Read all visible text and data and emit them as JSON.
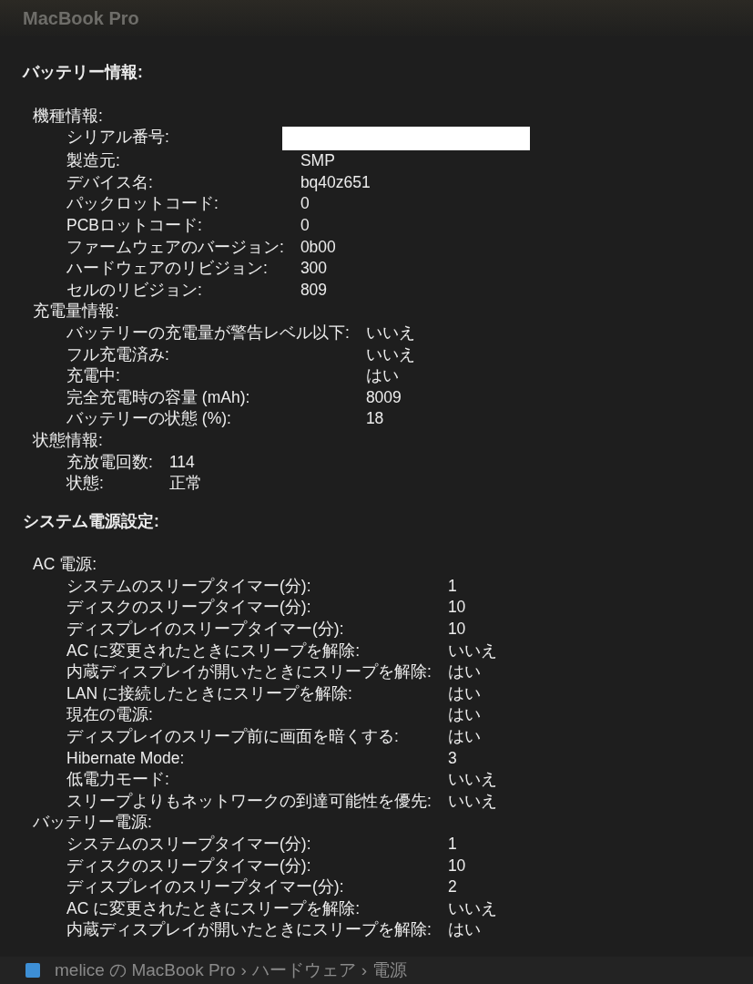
{
  "window": {
    "title": "MacBook Pro"
  },
  "sections": [
    {
      "heading": "バッテリー情報:",
      "groups": [
        {
          "label": "機種情報:",
          "rows": [
            {
              "label": "シリアル番号:",
              "redacted": true
            },
            {
              "label": "製造元:",
              "value": "SMP"
            },
            {
              "label": "デバイス名:",
              "value": "bq40z651"
            },
            {
              "label": "パックロットコード:",
              "value": "0"
            },
            {
              "label": "PCBロットコード:",
              "value": "0"
            },
            {
              "label": "ファームウェアのバージョン:",
              "value": "0b00"
            },
            {
              "label": "ハードウェアのリビジョン:",
              "value": "300"
            },
            {
              "label": "セルのリビジョン:",
              "value": "809"
            }
          ]
        },
        {
          "label": "充電量情報:",
          "rows": [
            {
              "label": "バッテリーの充電量が警告レベル以下:",
              "value": "いいえ"
            },
            {
              "label": "フル充電済み:",
              "value": "いいえ"
            },
            {
              "label": "充電中:",
              "value": "はい"
            },
            {
              "label": "完全充電時の容量 (mAh):",
              "value": "8009"
            },
            {
              "label": "バッテリーの状態 (%):",
              "value": "18"
            }
          ]
        },
        {
          "label": "状態情報:",
          "rows": [
            {
              "label": "充放電回数:",
              "value": "114"
            },
            {
              "label": "状態:",
              "value": "正常"
            }
          ]
        }
      ]
    },
    {
      "heading": "システム電源設定:",
      "groups": [
        {
          "label": "AC 電源:",
          "rows": [
            {
              "label": "システムのスリープタイマー(分):",
              "value": "1"
            },
            {
              "label": "ディスクのスリープタイマー(分):",
              "value": "10"
            },
            {
              "label": "ディスプレイのスリープタイマー(分):",
              "value": "10"
            },
            {
              "label": "AC に変更されたときにスリープを解除:",
              "value": "いいえ"
            },
            {
              "label": "内蔵ディスプレイが開いたときにスリープを解除:",
              "value": "はい"
            },
            {
              "label": "LAN に接続したときにスリープを解除:",
              "value": "はい"
            },
            {
              "label": "現在の電源:",
              "value": "はい"
            },
            {
              "label": "ディスプレイのスリープ前に画面を暗くする:",
              "value": "はい"
            },
            {
              "label": "Hibernate Mode:",
              "value": "3"
            },
            {
              "label": "低電力モード:",
              "value": "いいえ"
            },
            {
              "label": "スリープよりもネットワークの到達可能性を優先:",
              "value": "いいえ"
            }
          ]
        },
        {
          "label": "バッテリー電源:",
          "rows": [
            {
              "label": "システムのスリープタイマー(分):",
              "value": "1"
            },
            {
              "label": "ディスクのスリープタイマー(分):",
              "value": "10"
            },
            {
              "label": "ディスプレイのスリープタイマー(分):",
              "value": "2"
            },
            {
              "label": "AC に変更されたときにスリープを解除:",
              "value": "いいえ"
            },
            {
              "label": "内蔵ディスプレイが開いたときにスリープを解除:",
              "value": "はい"
            }
          ]
        }
      ]
    }
  ],
  "path_bar": {
    "items": [
      "melice の MacBook Pro",
      "ハードウェア",
      "電源"
    ],
    "separator": "›"
  }
}
